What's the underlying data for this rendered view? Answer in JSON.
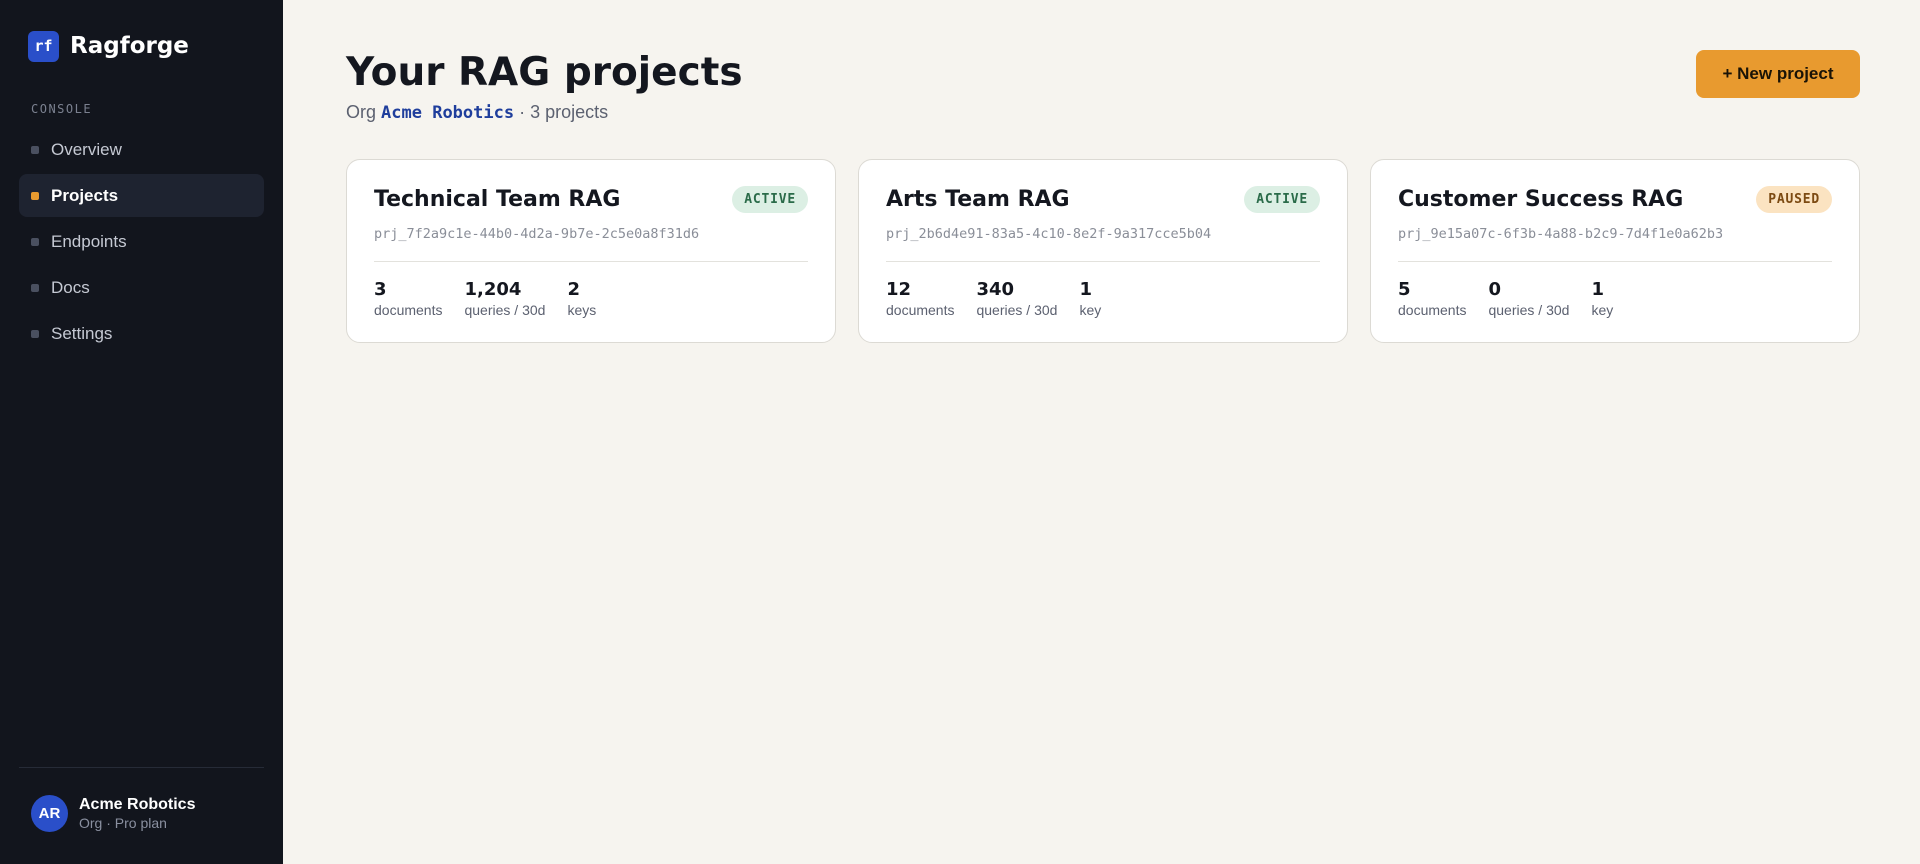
{
  "brand": {
    "logo_text": "rf",
    "name": "Ragforge"
  },
  "sidebar": {
    "section_label": "CONSOLE",
    "items": [
      {
        "label": "Overview",
        "active": false
      },
      {
        "label": "Projects",
        "active": true
      },
      {
        "label": "Endpoints",
        "active": false
      },
      {
        "label": "Docs",
        "active": false
      },
      {
        "label": "Settings",
        "active": false
      }
    ],
    "account": {
      "initials": "AR",
      "name": "Acme Robotics",
      "plan": "Org · Pro plan"
    }
  },
  "header": {
    "title": "Your RAG projects",
    "org_prefix": "Org",
    "org_name": "Acme Robotics",
    "project_count_text": "· 3 projects",
    "new_button_label": "+ New project"
  },
  "projects": [
    {
      "name": "Technical Team RAG",
      "status": "ACTIVE",
      "id": "prj_7f2a9c1e-44b0-4d2a-9b7e-2c5e0a8f31d6",
      "stats": [
        {
          "value": "3",
          "label": "documents"
        },
        {
          "value": "1,204",
          "label": "queries / 30d"
        },
        {
          "value": "2",
          "label": "keys"
        }
      ]
    },
    {
      "name": "Arts Team RAG",
      "status": "ACTIVE",
      "id": "prj_2b6d4e91-83a5-4c10-8e2f-9a317cce5b04",
      "stats": [
        {
          "value": "12",
          "label": "documents"
        },
        {
          "value": "340",
          "label": "queries / 30d"
        },
        {
          "value": "1",
          "label": "key"
        }
      ]
    },
    {
      "name": "Customer Success RAG",
      "status": "PAUSED",
      "id": "prj_9e15a07c-6f3b-4a88-b2c9-7d4f1e0a62b3",
      "stats": [
        {
          "value": "5",
          "label": "documents"
        },
        {
          "value": "0",
          "label": "queries / 30d"
        },
        {
          "value": "1",
          "label": "key"
        }
      ]
    }
  ],
  "colors": {
    "sidebar_bg": "#12151d",
    "accent": "#e89a2f",
    "brand_blue": "#2a4fc9",
    "active_badge": "#dcefe4",
    "paused_badge": "#fbe3c1"
  }
}
